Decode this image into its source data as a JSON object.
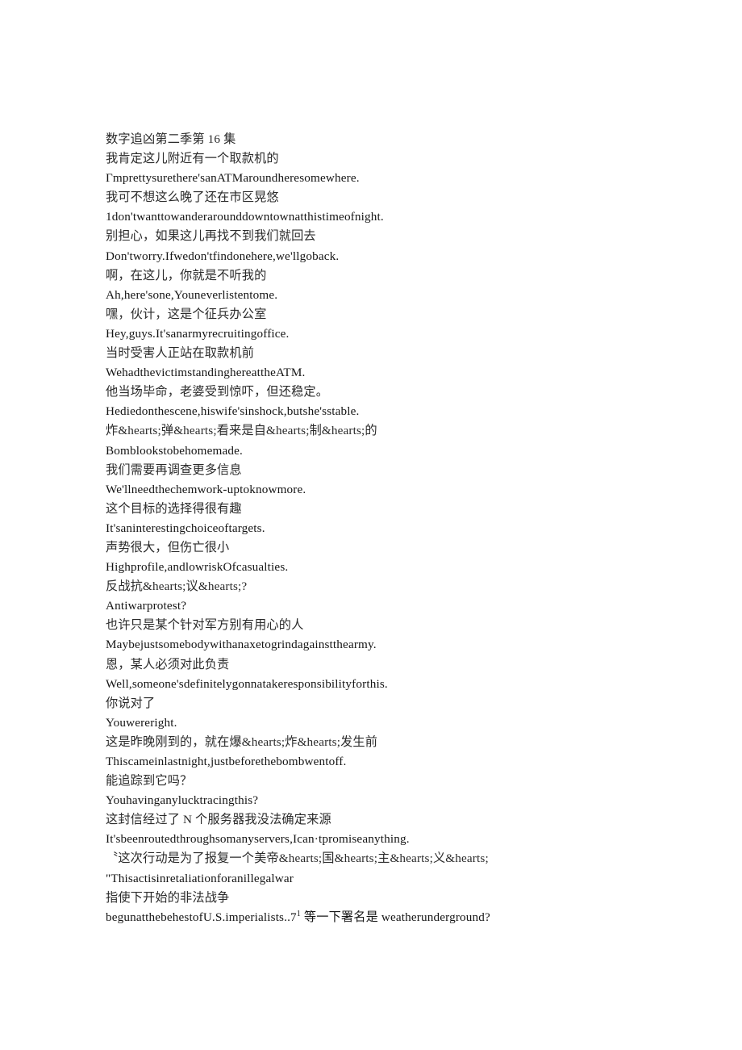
{
  "document": {
    "title": "数字追凶第二季第 16 集",
    "background_color": "#ffffff",
    "text_color": "#1b1b1b",
    "lines": [
      {
        "id": "title",
        "lang": "cn",
        "text": "数字追凶第二季第 16 集"
      },
      {
        "id": "l1-cn",
        "lang": "cn",
        "text": "我肯定这儿附近有一个取款机的"
      },
      {
        "id": "l1-en",
        "lang": "en",
        "text": "Γmprettysurethere'sanATMaroundheresomewhere."
      },
      {
        "id": "l2-cn",
        "lang": "cn",
        "text": "我可不想这么晚了还在市区晃悠"
      },
      {
        "id": "l2-en",
        "lang": "en",
        "text": "1don'twanttowanderarounddowntownatthistimeofnight."
      },
      {
        "id": "l3-cn",
        "lang": "cn",
        "text": "别担心，如果这儿再找不到我们就回去"
      },
      {
        "id": "l3-en",
        "lang": "en",
        "text": "Don'tworry.Ifwedon'tfindonehere,we'llgoback."
      },
      {
        "id": "l4-cn",
        "lang": "cn",
        "text": "啊，在这儿，你就是不听我的"
      },
      {
        "id": "l4-en",
        "lang": "en",
        "text": "Ah,here'sone,Youneverlistentome."
      },
      {
        "id": "l5-cn",
        "lang": "cn",
        "text": "嘿，伙计，这是个征兵办公室"
      },
      {
        "id": "l5-en",
        "lang": "en",
        "text": "Hey,guys.It'sanarmyrecruitingoffice."
      },
      {
        "id": "l6-cn",
        "lang": "cn",
        "text": "当时受害人正站在取款机前"
      },
      {
        "id": "l6-en",
        "lang": "en",
        "text": "WehadthevictimstandinghereattheATM."
      },
      {
        "id": "l7-cn",
        "lang": "cn",
        "text": "他当场毕命，老婆受到惊吓，但还稳定。"
      },
      {
        "id": "l7-en",
        "lang": "en",
        "text": "Hediedonthescene,hiswife'sinshock,butshe'sstable."
      },
      {
        "id": "l8-cn",
        "lang": "cn",
        "text": "炸&hearts;弹&hearts;看来是自&hearts;制&hearts;的"
      },
      {
        "id": "l8-en",
        "lang": "en",
        "text": "Bomblookstobehomemade."
      },
      {
        "id": "l9-cn",
        "lang": "cn",
        "text": "我们需要再调查更多信息"
      },
      {
        "id": "l9-en",
        "lang": "en",
        "text": "We'llneedthechemwork-uptoknowmore."
      },
      {
        "id": "l10-cn",
        "lang": "cn",
        "text": "这个目标的选择得很有趣"
      },
      {
        "id": "l10-en",
        "lang": "en",
        "text": "It'saninterestingchoiceoftargets."
      },
      {
        "id": "l11-cn",
        "lang": "cn",
        "text": "声势很大，但伤亡很小"
      },
      {
        "id": "l11-en",
        "lang": "en",
        "text": "Highprofile,andlowriskOfcasualties."
      },
      {
        "id": "l12-cn",
        "lang": "cn",
        "text": "反战抗&hearts;议&hearts;?"
      },
      {
        "id": "l12-en",
        "lang": "en",
        "text": "Antiwarprotest?"
      },
      {
        "id": "l13-cn",
        "lang": "cn",
        "text": "也许只是某个针对军方别有用心的人"
      },
      {
        "id": "l13-en",
        "lang": "en",
        "text": "Maybejustsomebodywithanaxetogrindagainstthearmy."
      },
      {
        "id": "l14-cn",
        "lang": "cn",
        "text": "恩，某人必须对此负责"
      },
      {
        "id": "l14-en",
        "lang": "en",
        "text": "Well,someone'sdefinitelygonnatakeresponsibilityforthis."
      },
      {
        "id": "l15-cn",
        "lang": "cn",
        "text": "你说对了"
      },
      {
        "id": "l15-en",
        "lang": "en",
        "text": "Youwereright."
      },
      {
        "id": "l16-cn",
        "lang": "cn",
        "text": "这是昨晚刚到的，就在爆&hearts;炸&hearts;发生前"
      },
      {
        "id": "l16-en",
        "lang": "en",
        "text": "Thiscameinlastnight,justbeforethebombwentoff."
      },
      {
        "id": "l17-cn",
        "lang": "cn",
        "text": "能追踪到它吗？"
      },
      {
        "id": "l17-en",
        "lang": "en",
        "text": "Youhavinganylucktracingthis?"
      },
      {
        "id": "l18-cn",
        "lang": "cn",
        "text": "这封信经过了 N 个服务器我没法确定来源"
      },
      {
        "id": "l18-en",
        "lang": "en",
        "text": "It'sbeenroutedthroughsomanyservers,Ican·tpromiseanything."
      },
      {
        "id": "l19-cn",
        "lang": "cn",
        "text": "〝这次行动是为了报复一个美帝&hearts;国&hearts;主&hearts;义&hearts;"
      },
      {
        "id": "l19-en",
        "lang": "en",
        "text": "\"Thisactisinretaliationforanillegalwar"
      },
      {
        "id": "l20-cn",
        "lang": "cn",
        "text": "指使下开始的非法战争"
      },
      {
        "id": "l20-en",
        "lang": "en",
        "text": "begunatthebehestofU.S.imperialists..7"
      },
      {
        "id": "l20-sup",
        "lang": "en",
        "text": "1"
      },
      {
        "id": "l20-tail",
        "lang": "cn",
        "text": " 等一下署名是 weatherunderground?"
      }
    ]
  }
}
